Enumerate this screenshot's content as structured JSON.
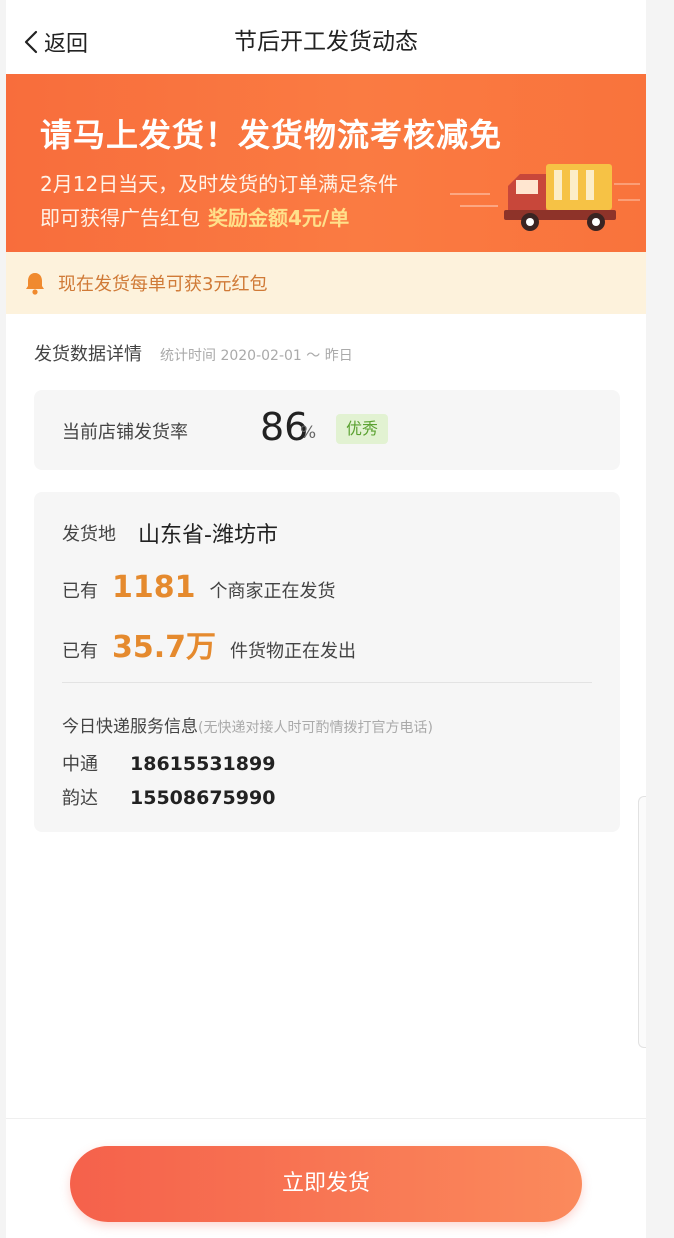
{
  "nav": {
    "back_label": "返回",
    "title": "节后开工发货动态"
  },
  "banner": {
    "title": "请马上发货！发货物流考核减免",
    "line1": "2月12日当天，及时发货的订单满足条件",
    "line2_prefix": "即可获得广告红包",
    "line2_highlight": "奖励金额4元/单"
  },
  "notice": {
    "text": "现在发货每单可获3元红包"
  },
  "stats_section": {
    "title": "发货数据详情",
    "subtitle": "统计时间 2020-02-01 ～ 昨日"
  },
  "rate": {
    "label": "当前店铺发货率",
    "value": "86",
    "unit": "%",
    "badge": "优秀"
  },
  "info": {
    "location_label": "发货地",
    "location_value": "山东省-潍坊市",
    "merchants": {
      "prefix": "已有",
      "value": "1181",
      "suffix": "个商家正在发货"
    },
    "goods": {
      "prefix": "已有",
      "value": "35.7万",
      "suffix": "件货物正在发出"
    },
    "express_title": "今日快递服务信息",
    "express_note": "(无快递对接人时可酌情拨打官方电话)",
    "couriers": [
      {
        "name": "中通",
        "phone": "18615531899"
      },
      {
        "name": "韵达",
        "phone": "15508675990"
      }
    ]
  },
  "action": {
    "button_label": "立即发货"
  },
  "colors": {
    "accent": "#f86d3c",
    "highlight_number": "#e58a2e",
    "badge_green": "#5aa130",
    "notice_bg": "#fdf2dc"
  }
}
